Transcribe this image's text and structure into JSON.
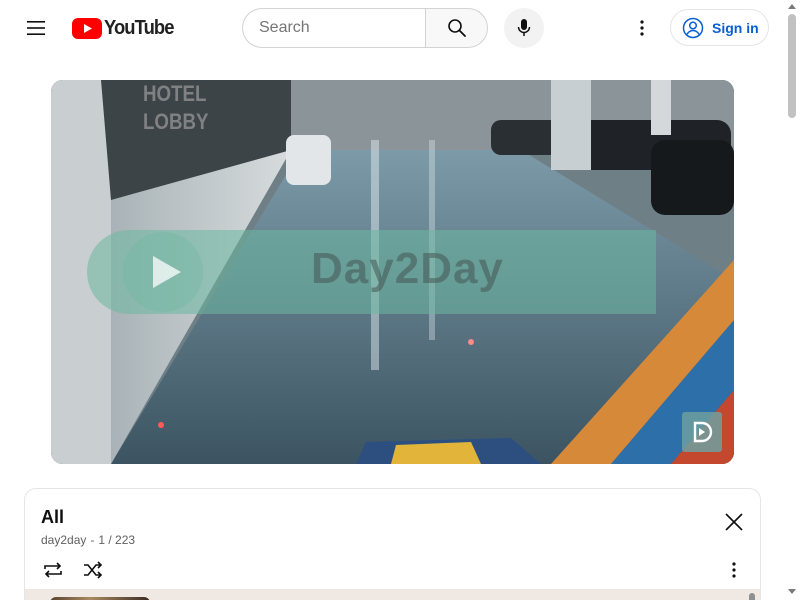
{
  "masthead": {
    "logo_text": "YouTube",
    "search": {
      "placeholder": "Search",
      "value": ""
    },
    "sign_in_label": "Sign in",
    "icons": {
      "menu": "hamburger-icon",
      "logo": "youtube-play-icon",
      "search": "search-icon",
      "mic": "microphone-icon",
      "more": "more-vertical-icon",
      "account": "account-circle-icon"
    }
  },
  "player": {
    "watermark": "Day2Day",
    "sign_text": "HOTEL\nLOBBY",
    "badge_icon": "day2day-channel-icon"
  },
  "playlist": {
    "title": "All",
    "channel": "day2day",
    "separator": "-",
    "position": "1 / 223",
    "icons": {
      "close": "close-icon",
      "loop": "loop-icon",
      "shuffle": "shuffle-icon",
      "menu": "more-vertical-icon"
    }
  },
  "colors": {
    "brand_red": "#FF0000",
    "link_blue": "#065fd4",
    "text_primary": "#0f0f0f",
    "text_secondary": "#606060"
  }
}
